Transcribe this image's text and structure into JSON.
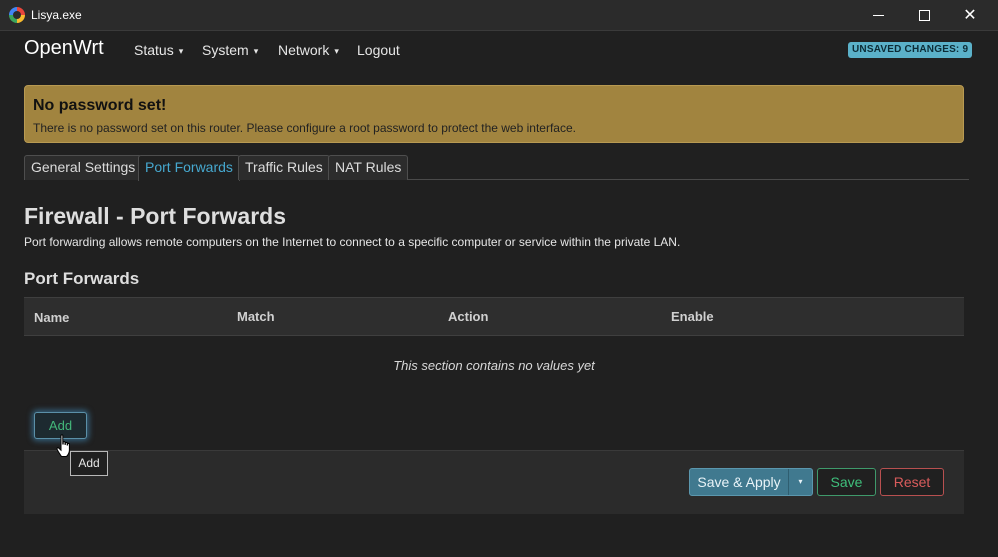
{
  "window": {
    "title": "Lisya.exe",
    "app_icon": "chrome-like-icon",
    "controls": [
      "minimize-icon",
      "maximize-icon",
      "close-icon"
    ]
  },
  "nav": {
    "brand": "OpenWrt",
    "items": [
      {
        "label": "Status",
        "caret": "▾"
      },
      {
        "label": "System",
        "caret": "▾"
      },
      {
        "label": "Network",
        "caret": "▾"
      },
      {
        "label": "Logout",
        "caret": ""
      }
    ],
    "unsaved_badge": "UNSAVED CHANGES: 9"
  },
  "alert": {
    "title": "No password set!",
    "text": "There is no password set on this router. Please configure a root password to protect the web interface."
  },
  "tabs": [
    {
      "label": "General Settings",
      "active": false
    },
    {
      "label": "Port Forwards",
      "active": true
    },
    {
      "label": "Traffic Rules",
      "active": false
    },
    {
      "label": "NAT Rules",
      "active": false
    }
  ],
  "page": {
    "title": "Firewall - Port Forwards",
    "description": "Port forwarding allows remote computers on the Internet to connect to a specific computer or service within the private LAN.",
    "section_title": "Port Forwards"
  },
  "table": {
    "columns": [
      "Name",
      "Match",
      "Action",
      "Enable"
    ],
    "empty_text": "This section contains no values yet"
  },
  "add_button": {
    "label": "Add",
    "tooltip": "Add"
  },
  "footer": {
    "save_apply": "Save & Apply",
    "dropdown_caret": "▾",
    "save": "Save",
    "reset": "Reset"
  },
  "colors": {
    "background": "#202020",
    "alert": "#a1843f",
    "accent": "#46a8cf",
    "badge": "#5bb1c9",
    "save_apply": "#40798f",
    "save": "#3fbf7c",
    "reset": "#d95c5c"
  }
}
